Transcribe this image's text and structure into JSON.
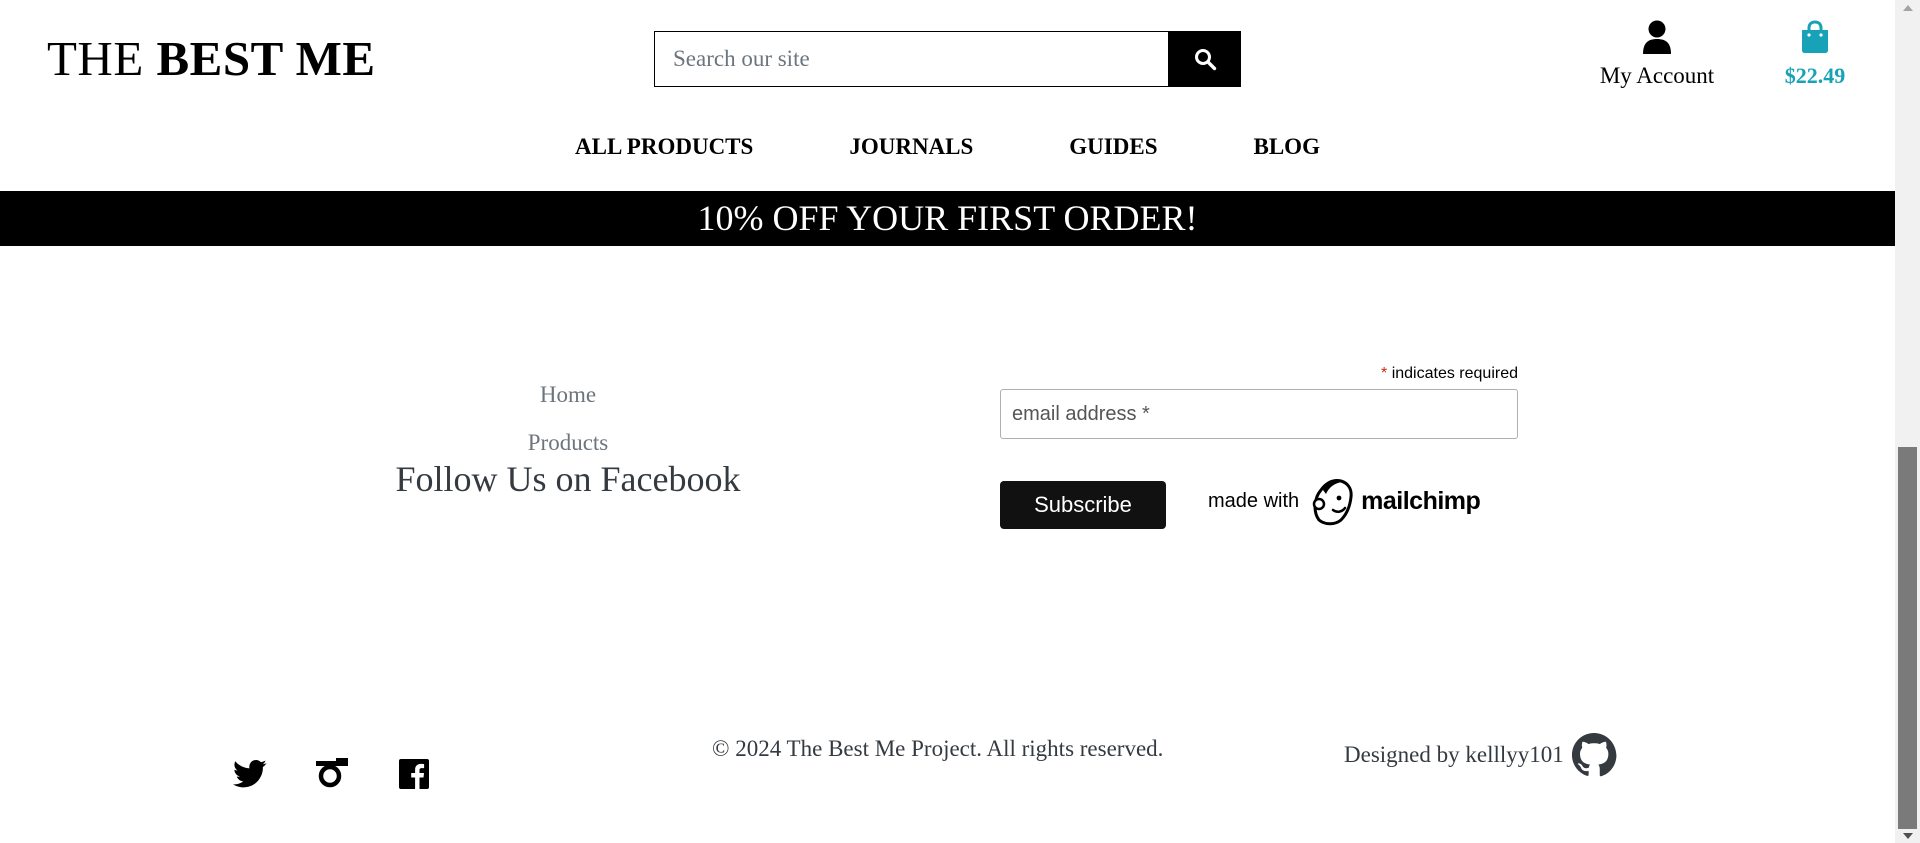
{
  "brand": {
    "part1": "THE ",
    "part2": "BEST ME"
  },
  "search": {
    "placeholder": "Search our site",
    "icon": "magnifier"
  },
  "account": {
    "label": "My Account",
    "icon": "user"
  },
  "cart": {
    "amount": "$22.49",
    "icon": "shopping-bag",
    "color": "#17a2b8"
  },
  "nav": [
    "ALL PRODUCTS",
    "JOURNALS",
    "GUIDES",
    "BLOG"
  ],
  "banner": "10% OFF YOUR FIRST ORDER!",
  "footer_links": {
    "home": "Home",
    "products": "Products",
    "facebook": "Follow Us on Facebook"
  },
  "newsletter": {
    "required_mark": "*",
    "required_text": " indicates required",
    "email_placeholder": "email address *",
    "subscribe": "Subscribe",
    "made_with": "made with",
    "brand": "mailchimp"
  },
  "social": [
    "twitter",
    "instagram",
    "facebook"
  ],
  "copyright": "© 2024 The Best Me Project. All rights reserved.",
  "designed_by": "Designed by kelllyy101",
  "colors": {
    "accent": "#17a2b8",
    "banner_bg": "#000000",
    "muted": "#6c757d",
    "required": "#c02b0a"
  }
}
